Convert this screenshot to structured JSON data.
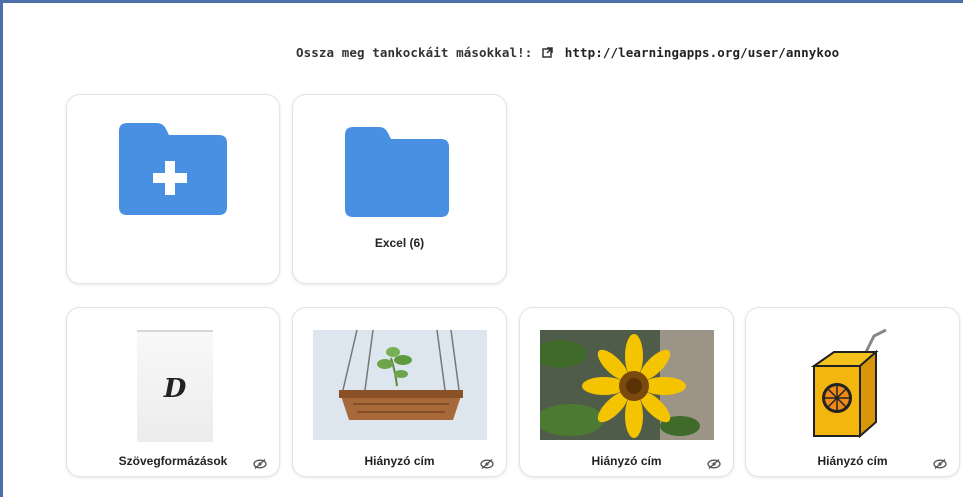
{
  "share": {
    "label": "Ossza meg tankockáit másokkal!:",
    "link": "http://learningapps.org/user/annykoo"
  },
  "folders": [
    {
      "label": "",
      "icon": "folder-add-icon"
    },
    {
      "label": "Excel (6)",
      "icon": "folder-icon"
    }
  ],
  "apps": [
    {
      "title": "Szövegformázások",
      "thumb_letter": "D"
    },
    {
      "title": "Hiányzó cím"
    },
    {
      "title": "Hiányzó cím"
    },
    {
      "title": "Hiányzó cím"
    }
  ],
  "colors": {
    "folder": "#4a90e2",
    "frame_border": "#4f6fa8"
  }
}
